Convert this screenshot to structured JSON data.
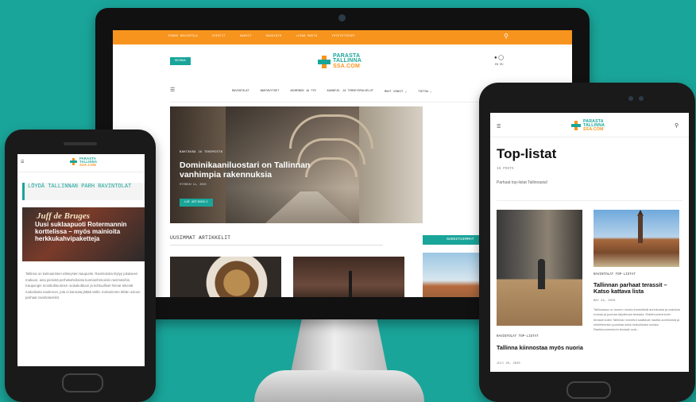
{
  "desktop": {
    "top_nav": [
      "PARAS RAVINTOLA",
      "VIESTIT",
      "KAHVIT",
      "HAVAINTO",
      "LISÄÄ MUUTA",
      "YHTEYSTIEDOT"
    ],
    "search_icon": "search-icon",
    "follow_button": "SEURAA",
    "logo": {
      "line1": "PARASTA",
      "line2": "TALLINNA",
      "line3": "SSA.COM"
    },
    "lang": "EN   RU",
    "menu": [
      "RAVINTOLAT",
      "NÄHTÄVYYDET",
      "ASUMINEN JA TYÖ",
      "KAUNEUS- JA TERVEYSPALVELUT",
      "MUUT VINKIT ⌄",
      "TIETOA ⌄"
    ],
    "hero": {
      "category": "NÄHTÄVÄÄ JA TEKEMISTÄ",
      "title": "Dominikaaniluostari on Tallinnan vanhimpia rakennuksia",
      "meta": "SYYSKUU 11, 2020",
      "button": "LUE ARTIKKELI"
    },
    "latest_heading": "UUSIMMAT ARTIKKELIT",
    "sidebar_heading": "SUOSITUIMMAT"
  },
  "phone": {
    "logo": {
      "line1": "PARASTA",
      "line2": "TALLINNA",
      "line3": "SSA.COM"
    },
    "category": "LÖYDÄ TALLINNAN PARH RAVINTOLAT",
    "card_sign": "Juff de Bruges",
    "card_caption": "Uusi suklaapuoti Rotermannin korttelissa – myös mainioita herkkukahvipaketteja",
    "body": "Tallinna on kulinaaristen elämysten kaupunki. Ravintoloita löytyy jokaiseen makuun, aina pienistä perhekahviloista kunnianhimoisiin ravintoloihin. Kaupungin monikulttuurinen ruokakulttuuri ja kohtuulliset hinnat tekevät ruokailusta nautinnon, jota ei kannata jättää väliin. Kokosimme tähän osioon parhaat ravintolavinkit."
  },
  "tablet": {
    "logo": {
      "line1": "PARASTA",
      "line2": "TALLINNA",
      "line3": "SSA.COM"
    },
    "title": "Top-listat",
    "count": "16 POSTS",
    "subtitle": "Parhaat top-listat Tallinnasta!",
    "post2": {
      "category": "RAVINTOLAT  TOP-LISTAT",
      "title": "Tallinnan parhaat terassit – Katso kattava lista",
      "date": "MAY 24, 2020",
      "text": "Tallinnassa on monen monta ihmeellistä aurinkoista ja mainiota ruokaa ja juomaa tarjoilevaa terassia. Rakkhuoneentorin terassit kuten Tallinnan tunnetut saattavat nauttia aurinkoista ja mielelleenkin juomista sekä herkullisista ruoista. Raekhuoneentorin terassit ovat..."
    },
    "post1": {
      "category": "RAVINTOLAT  TOP-LISTAT",
      "title": "Tallinna kiinnostaa myös nuoria",
      "date": "JULY 20, 2020"
    }
  },
  "colors": {
    "brand_teal": "#1aa59a",
    "brand_orange": "#f7941d",
    "bg": "#1aa59a"
  }
}
